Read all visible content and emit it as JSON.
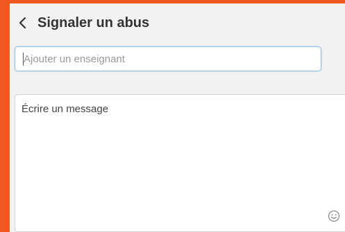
{
  "header": {
    "back_icon": "chevron-left-icon",
    "title": "Signaler un abus"
  },
  "form": {
    "recipient_placeholder": "Ajouter un enseignant",
    "message_placeholder": "Écrire un message",
    "emoji_icon": "smiley-icon"
  },
  "colors": {
    "frame": "#f05a22",
    "panel_background": "#f2f2f2",
    "focus_border": "#8ec3e6",
    "title_text": "#333333"
  }
}
